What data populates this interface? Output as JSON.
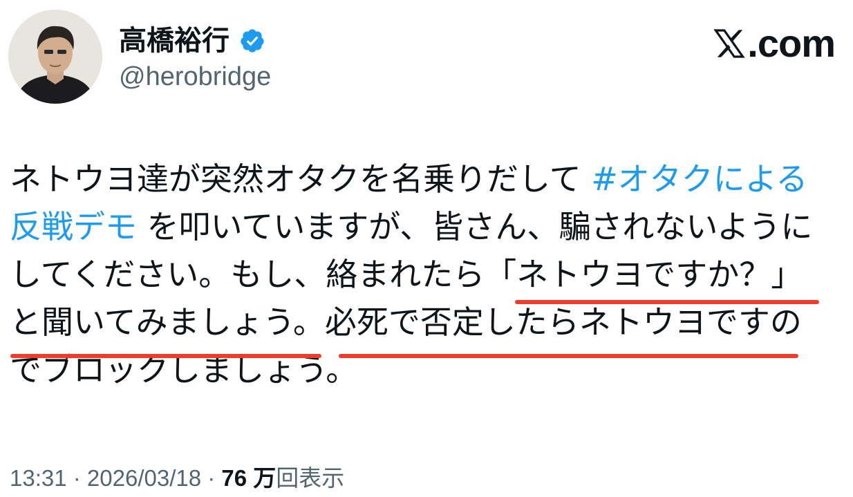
{
  "author": {
    "display_name": "高橋裕行",
    "handle": "@herobridge",
    "verified": true
  },
  "branding": {
    "site": ".com",
    "logo_icon": "x-logo-icon"
  },
  "tweet": {
    "lines": [
      {
        "segments": [
          {
            "text": "ネトウヨ達が突然オタクを名乗りだして "
          },
          {
            "text": "#オタクによる",
            "hashtag": true
          }
        ]
      },
      {
        "segments": [
          {
            "text": "反戦デモ",
            "hashtag": true
          },
          {
            "text": " を叩いていますが、皆さん、騙されないように"
          }
        ]
      },
      {
        "segments": [
          {
            "text": "してください。もし、絡まれたら「ネトウヨですか？」"
          }
        ]
      },
      {
        "segments": [
          {
            "text": "と聞いてみましょう。必死で否定したらネトウヨですの"
          }
        ]
      },
      {
        "segments": [
          {
            "text": "でブロックしましょう。"
          }
        ]
      }
    ]
  },
  "meta": {
    "time": "13:31",
    "date": "2026/03/18",
    "separator": " · ",
    "views_count": "76 万",
    "views_label": "回表示"
  },
  "colors": {
    "hashtag": "#1d9bf0",
    "underline": "#ee3b2a",
    "verified_badge": "#1d9bf0",
    "secondary_text": "#536471"
  }
}
